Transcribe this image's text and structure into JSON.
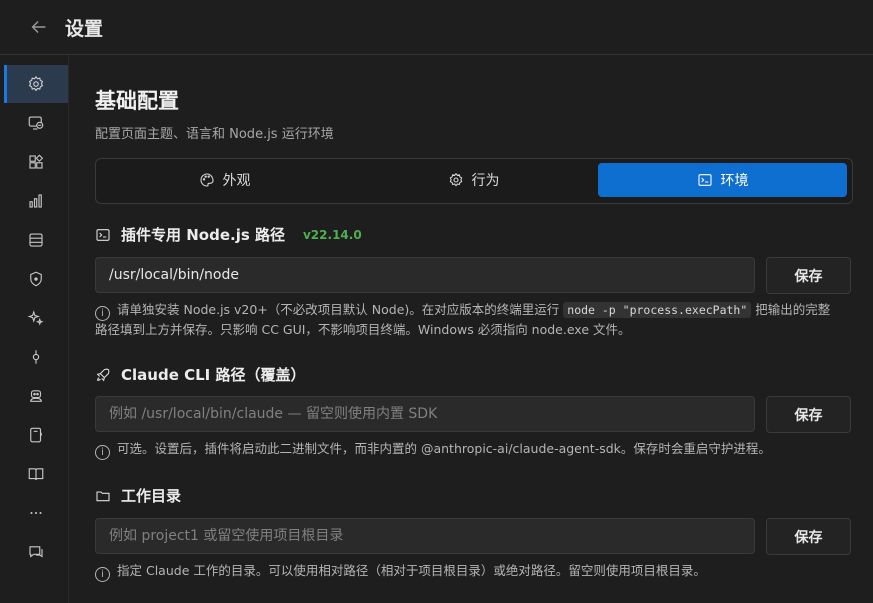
{
  "header": {
    "title": "设置",
    "back_icon": "arrow-left-icon"
  },
  "sidebar": {
    "items": [
      {
        "icon": "gear-icon",
        "active": true
      },
      {
        "icon": "monitor-cloud-icon"
      },
      {
        "icon": "apps-grid-icon"
      },
      {
        "icon": "bar-chart-icon"
      },
      {
        "icon": "database-icon"
      },
      {
        "icon": "shield-icon"
      },
      {
        "icon": "sparkles-icon"
      },
      {
        "icon": "commit-icon"
      },
      {
        "icon": "robot-icon"
      },
      {
        "icon": "phone-icon"
      },
      {
        "icon": "book-icon"
      },
      {
        "icon": "more-horizontal-icon"
      },
      {
        "icon": "chat-icon"
      }
    ]
  },
  "main": {
    "heading": "基础配置",
    "subtitle": "配置页面主题、语言和 Node.js 运行环境",
    "tabs": [
      {
        "label": "外观",
        "icon": "palette-icon"
      },
      {
        "label": "行为",
        "icon": "gear-icon"
      },
      {
        "label": "环境",
        "icon": "terminal-icon",
        "active": true
      }
    ],
    "node_section": {
      "title": "插件专用 Node.js 路径",
      "version": "v22.14.0",
      "value": "/usr/local/bin/node",
      "save_label": "保存",
      "hint_1": "请单独安装 Node.js v20+（不必改项目默认 Node)。在对应版本的终端里运行",
      "hint_code": "node -p \"process.execPath\"",
      "hint_2": "把输出的完整",
      "hint_3": "路径填到上方并保存。只影响 CC GUI，不影响项目终端。Windows 必须指向 node.exe 文件。"
    },
    "cli_section": {
      "title": "Claude CLI 路径（覆盖）",
      "placeholder": "例如 /usr/local/bin/claude — 留空则使用内置 SDK",
      "save_label": "保存",
      "hint": "可选。设置后，插件将启动此二进制文件，而非内置的 @anthropic-ai/claude-agent-sdk。保存时会重启守护进程。"
    },
    "workdir_section": {
      "title": "工作目录",
      "placeholder": "例如 project1 或留空使用项目根目录",
      "save_label": "保存",
      "hint": "指定 Claude 工作的目录。可以使用相对路径（相对于项目根目录）或绝对路径。留空则使用项目根目录。"
    }
  },
  "colors": {
    "accent": "#0f6fd1",
    "version_green": "#4caf50",
    "background": "#1e1e1e"
  }
}
